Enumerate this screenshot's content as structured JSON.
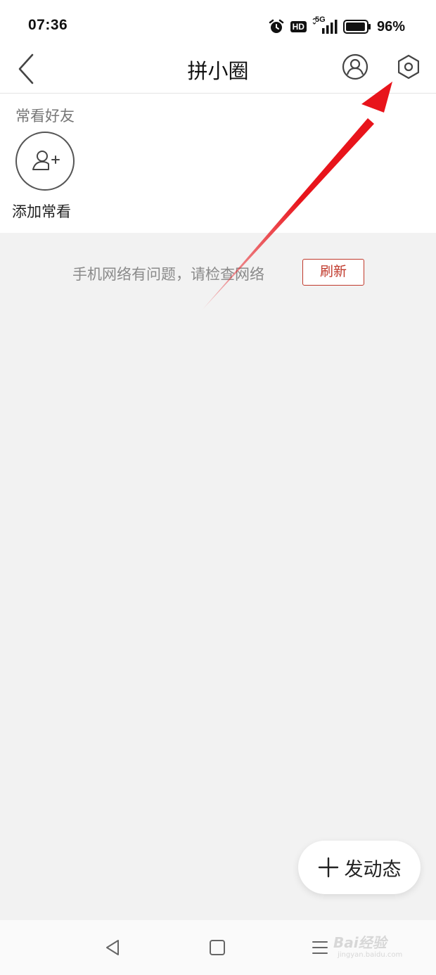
{
  "status_bar": {
    "time": "07:36",
    "network_type": "5G",
    "hd_label": "HD",
    "battery_percent": "96%",
    "battery_level": 0.96
  },
  "header": {
    "title": "拼小圈",
    "back_icon": "chevron-left-icon",
    "profile_icon": "user-circle-icon",
    "settings_icon": "gear-icon"
  },
  "friends": {
    "section_title": "常看好友",
    "add_label": "添加常看",
    "add_icon": "user-plus-icon"
  },
  "network": {
    "message": "手机网络有问题，请检查网络",
    "refresh_label": "刷新"
  },
  "post_button": {
    "icon": "plus-icon",
    "label": "发动态"
  },
  "system_nav": {
    "back": "triangle-back-icon",
    "home": "square-home-icon",
    "menu": "menu-lines-icon"
  },
  "watermark": {
    "text": "Bai经验",
    "sub": "jingyan.baidu.com"
  },
  "colors": {
    "accent_red": "#c0392b",
    "arrow_red": "#e8141b",
    "background": "#f2f2f2"
  }
}
